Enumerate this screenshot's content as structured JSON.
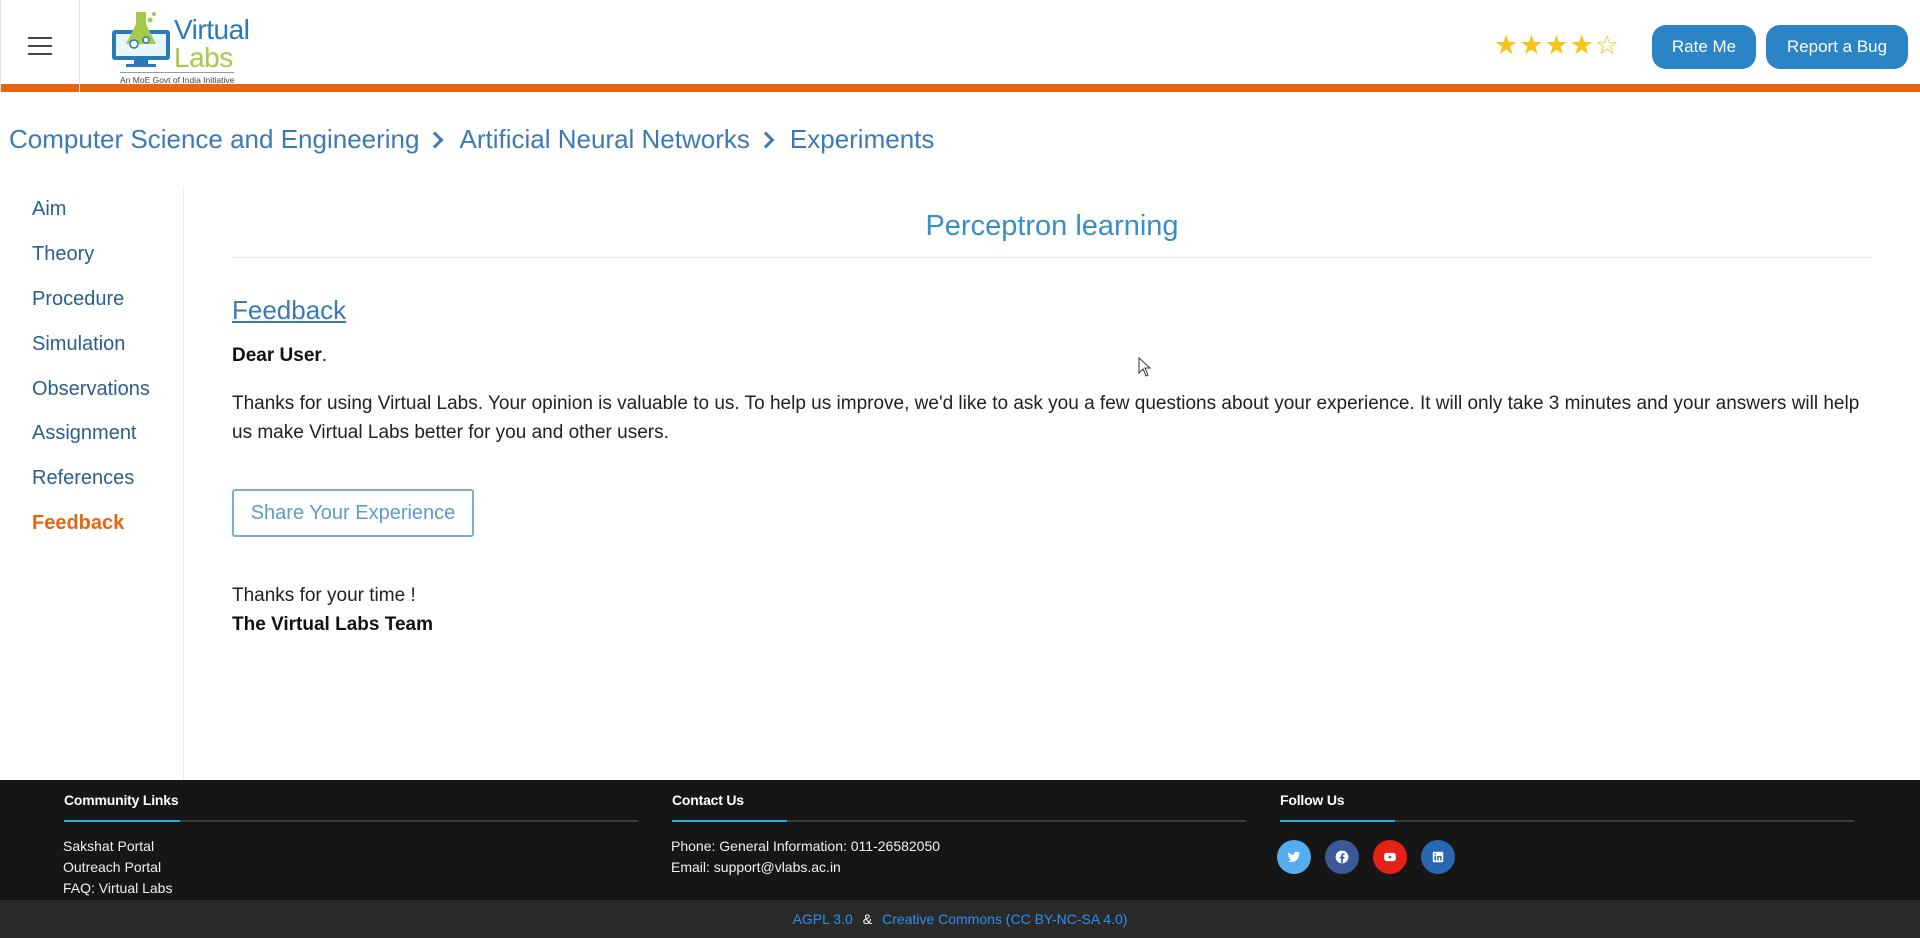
{
  "header": {
    "menu_icon": "hamburger-menu-icon",
    "logo": {
      "word1": "Virtual",
      "word2": "Labs",
      "tagline": "An MoE Govt of India Initiative"
    },
    "rating": {
      "filled": 4,
      "total": 5
    },
    "rate_label": "Rate Me",
    "bug_label": "Report a Bug",
    "accent_color": "#e8660f",
    "button_color": "#2a84c6"
  },
  "breadcrumb": [
    "Computer Science and Engineering",
    "Artificial Neural Networks",
    "Experiments"
  ],
  "sidebar": {
    "items": [
      {
        "label": "Aim",
        "active": false
      },
      {
        "label": "Theory",
        "active": false
      },
      {
        "label": "Procedure",
        "active": false
      },
      {
        "label": "Simulation",
        "active": false
      },
      {
        "label": "Observations",
        "active": false
      },
      {
        "label": "Assignment",
        "active": false
      },
      {
        "label": "References",
        "active": false
      },
      {
        "label": "Feedback",
        "active": true
      }
    ]
  },
  "main": {
    "title": "Perceptron learning",
    "section_heading": "Feedback",
    "greeting_bold": "Dear User",
    "greeting_tail": ".",
    "paragraph": "Thanks for using Virtual Labs. Your opinion is valuable to us. To help us improve, we'd like to ask you a few questions about your experience. It will only take 3 minutes and your answers will help us make Virtual Labs better for you and other users.",
    "share_button": "Share Your Experience",
    "thanks": "Thanks for your time !",
    "signature": "The Virtual Labs Team"
  },
  "footer": {
    "community": {
      "heading": "Community Links",
      "links": [
        "Sakshat Portal",
        "Outreach Portal",
        "FAQ: Virtual Labs"
      ]
    },
    "contact": {
      "heading": "Contact Us",
      "phone": "Phone: General Information: 011-26582050",
      "email": "Email: support@vlabs.ac.in"
    },
    "follow": {
      "heading": "Follow Us",
      "icons": [
        "twitter-icon",
        "facebook-icon",
        "youtube-icon",
        "linkedin-icon"
      ]
    },
    "license_1": "AGPL 3.0",
    "license_sep": "&",
    "license_2": "Creative Commons (CC BY-NC-SA 4.0)"
  }
}
